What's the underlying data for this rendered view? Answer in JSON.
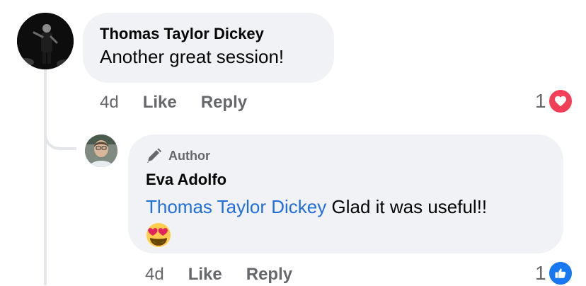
{
  "comment": {
    "author": "Thomas Taylor Dickey",
    "text": "Another great session!",
    "time": "4d",
    "like_label": "Like",
    "reply_label": "Reply",
    "reaction_count": "1",
    "reaction_icon": "heart-icon"
  },
  "reply": {
    "badge": "Author",
    "badge_icon": "pencil-icon",
    "author": "Eva Adolfo",
    "mention": "Thomas Taylor Dickey",
    "text": " Glad it was useful!!",
    "emoji": "heart-eyes-emoji",
    "time": "4d",
    "like_label": "Like",
    "reply_label": "Reply",
    "reaction_count": "1",
    "reaction_icon": "thumbs-up-icon"
  },
  "colors": {
    "bubble": "#f0f2f5",
    "mention": "#216fdb",
    "secondary_text": "#65676b",
    "heart": "#f33e58",
    "like": "#1877f2"
  }
}
